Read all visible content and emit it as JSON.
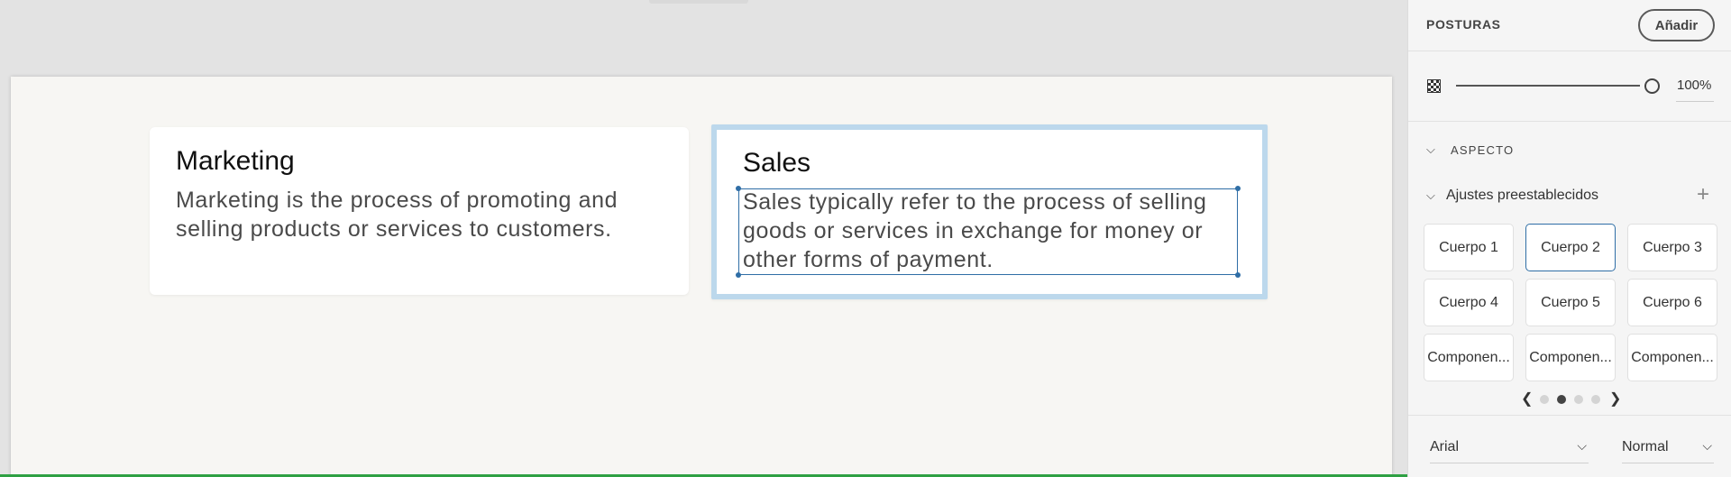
{
  "canvas": {
    "cards": [
      {
        "title": "Marketing",
        "body": "Marketing is the process of promoting and selling products or services to customers."
      },
      {
        "title": "Sales",
        "body": "Sales typically refer to the process of selling goods or services in exchange for money or other forms of payment."
      }
    ]
  },
  "panel": {
    "states_title": "POSTURAS",
    "add_label": "Añadir",
    "opacity": {
      "value": "100%",
      "level": 1.0
    },
    "appearance_title": "ASPECTO",
    "presets": {
      "title": "Ajustes preestablecidos",
      "items": [
        "Cuerpo 1",
        "Cuerpo 2",
        "Cuerpo 3",
        "Cuerpo 4",
        "Cuerpo 5",
        "Cuerpo 6",
        "Componen...",
        "Componen...",
        "Componen..."
      ],
      "selected_index": 1,
      "pager": {
        "pages": 4,
        "current": 2
      }
    },
    "font_family": "Arial",
    "font_style": "Normal"
  },
  "colors": {
    "accent": "#2f6ea6",
    "selection_border": "#bcd8ec",
    "artboard_bg": "#f7f6f3",
    "status_bar": "#2ea043"
  }
}
